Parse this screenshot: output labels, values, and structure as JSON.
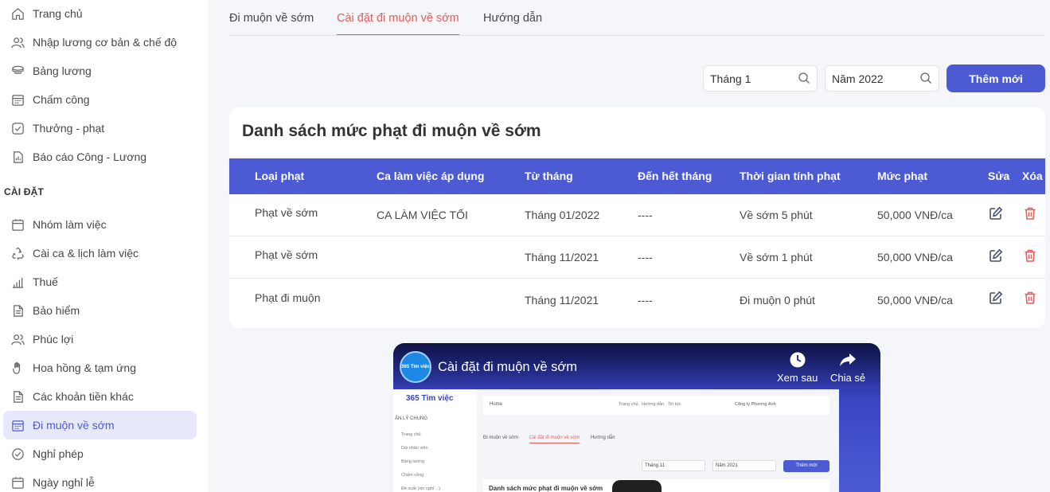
{
  "sidebar": {
    "items": [
      {
        "label": "Trang chủ",
        "icon": "home-icon"
      },
      {
        "label": "Nhập lương cơ bản & chế độ",
        "icon": "users-icon"
      },
      {
        "label": "Bảng lương",
        "icon": "coins-icon"
      },
      {
        "label": "Chấm công",
        "icon": "calendar-grid-icon"
      },
      {
        "label": "Thưởng - phạt",
        "icon": "check-square-icon"
      },
      {
        "label": "Báo cáo Công - Lương",
        "icon": "report-icon"
      }
    ],
    "section_label": "CÀI ĐẶT",
    "settings": [
      {
        "label": "Nhóm làm việc",
        "icon": "calendar-icon"
      },
      {
        "label": "Cài ca & lịch làm việc",
        "icon": "recycle-icon"
      },
      {
        "label": "Thuế",
        "icon": "bar-chart-icon"
      },
      {
        "label": "Bảo hiểm",
        "icon": "document-icon"
      },
      {
        "label": "Phúc lợi",
        "icon": "users-icon"
      },
      {
        "label": "Hoa hồng & tạm ứng",
        "icon": "hand-icon"
      },
      {
        "label": "Các khoản tiền khác",
        "icon": "document-icon"
      },
      {
        "label": "Đi muộn về sớm",
        "icon": "calendar-grid-icon",
        "active": true
      },
      {
        "label": "Nghỉ phép",
        "icon": "check-circle-icon"
      },
      {
        "label": "Ngày nghỉ lễ",
        "icon": "calendar-icon"
      }
    ]
  },
  "tabs": [
    "Đi muộn về sớm",
    "Cài đặt đi muộn về sớm",
    "Hướng dẫn"
  ],
  "active_tab": 1,
  "filters": {
    "month": "Tháng 1",
    "year": "Năm 2022"
  },
  "add_button": "Thêm mới",
  "card_title": "Danh sách mức phạt đi muộn về sớm",
  "table": {
    "headers": [
      "Loại phạt",
      "Ca làm việc áp dụng",
      "Từ tháng",
      "Đến hết tháng",
      "Thời gian tính phạt",
      "Mức phạt",
      "Sửa",
      "Xóa"
    ],
    "rows": [
      [
        "Phạt về sớm",
        "CA LÀM VIỆC TỐI",
        "Tháng 01/2022",
        "----",
        "Về sớm 5 phút",
        "50,000 VNĐ/ca"
      ],
      [
        "Phạt về sớm",
        "",
        "Tháng 11/2021",
        "----",
        "Về sớm 1 phút",
        "50,000 VNĐ/ca"
      ],
      [
        "Phạt đi muộn",
        "",
        "Tháng 11/2021",
        "----",
        "Đi muộn 0 phút",
        "50,000 VNĐ/ca"
      ]
    ]
  },
  "colors": {
    "accent": "#4c5bd4",
    "active_tab": "#e85d5d",
    "delete": "#e85d5d"
  },
  "video": {
    "title": "Cài đặt đi muộn về sớm",
    "watch_later": "Xem sau",
    "share": "Chia sẻ",
    "logo_text": "365 Tìm việc",
    "shot": {
      "logo": "365 Tìm việc",
      "section": "ẢN LÝ CHUNG",
      "nav": [
        "Trang chủ",
        "D/s nhân viên",
        "Bảng lương",
        "Chấm công",
        "Đề xuất (xin nghỉ ...)"
      ],
      "topbar": "Home",
      "topbar_links": "Trang chủ   Hướng dẫn   Tin tức",
      "company": "Công ty Phương Anh",
      "tabs": [
        "Đi muộn về sớm",
        "Cài đặt đi muộn về sớm",
        "Hướng dẫn"
      ],
      "month": "Tháng 11",
      "year": "Năm 2021",
      "add": "Thêm mới",
      "card": "Danh sách mức phạt đi muộn về sớm"
    }
  }
}
